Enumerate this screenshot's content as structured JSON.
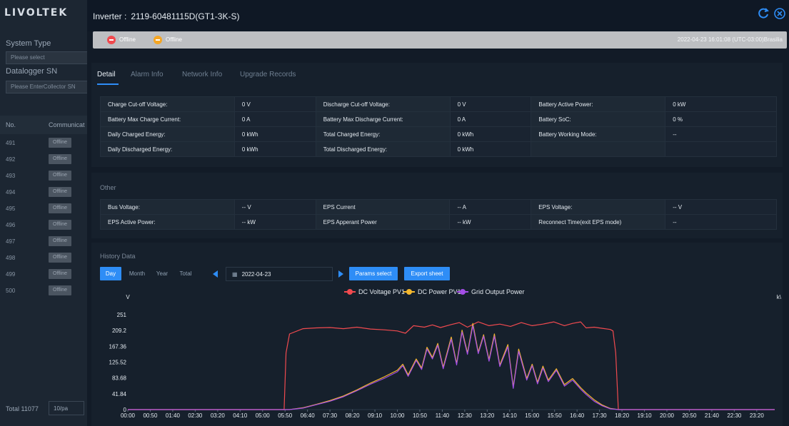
{
  "sidebar": {
    "logo": "LIVOLTEK",
    "system_type_label": "System Type",
    "system_type_placeholder": "Please select",
    "datalogger_label": "Datalogger SN",
    "datalogger_placeholder": "Please EnterCollector SN",
    "col_no": "No.",
    "col_comm": "Communicat",
    "rows": [
      {
        "no": "491",
        "status": "Offline"
      },
      {
        "no": "492",
        "status": "Offline"
      },
      {
        "no": "493",
        "status": "Offline"
      },
      {
        "no": "494",
        "status": "Offline"
      },
      {
        "no": "495",
        "status": "Offline"
      },
      {
        "no": "496",
        "status": "Offline"
      },
      {
        "no": "497",
        "status": "Offline"
      },
      {
        "no": "498",
        "status": "Offline"
      },
      {
        "no": "499",
        "status": "Offline"
      },
      {
        "no": "500",
        "status": "Offline"
      }
    ],
    "total": "Total 11077",
    "page_size": "10/pa"
  },
  "modal": {
    "title_label": "Inverter :",
    "title_value": "2119-60481115D(GT1-3K-S)",
    "status1": "Offline",
    "status2": "Offline",
    "timestamp": "2022-04-23 16:01:08 (UTC-03:00)Brasilia",
    "icons": {
      "refresh": "refresh-icon",
      "close": "close-icon"
    },
    "tabs": [
      "Detail",
      "Alarm Info",
      "Network Info",
      "Upgrade Records"
    ]
  },
  "battery": [
    [
      "Charge Cut-off Voltage:",
      "0 V",
      "Discharge Cut-off Voltage:",
      "0 V",
      "Battery Active Power:",
      "0 kW"
    ],
    [
      "Battery Max Charge Current:",
      "0 A",
      "Battery Max Discharge Current:",
      "0 A",
      "Battery SoC:",
      "0 %"
    ],
    [
      "Daily Charged Energy:",
      "0 kWh",
      "Total Charged Energy:",
      "0 kWh",
      "Battery Working Mode:",
      "--"
    ],
    [
      "Daily Discharged Energy:",
      "0 kWh",
      "Total Discharged Energy:",
      "0 kWh",
      "",
      ""
    ]
  ],
  "other": {
    "title": "Other",
    "rows": [
      [
        "Bus Voltage:",
        "-- V",
        "EPS Current",
        "-- A",
        "EPS Voltage:",
        "-- V"
      ],
      [
        "EPS Active Power:",
        "-- kW",
        "EPS Apperant Power",
        "-- kW",
        "Reconnect Time(exit EPS mode)",
        "--"
      ]
    ]
  },
  "history": {
    "title": "History Data",
    "ranges": [
      "Day",
      "Month",
      "Year",
      "Total"
    ],
    "active_range": "Day",
    "date": "2022-04-23",
    "params_btn": "Params select",
    "export_btn": "Export sheet"
  },
  "chart_data": {
    "type": "line",
    "ylabel_left": "V",
    "ylabel_right": "k\\",
    "yticks": [
      "0",
      "41.84",
      "83.68",
      "125.52",
      "167.36",
      "209.2",
      "251"
    ],
    "ylim": [
      0,
      251
    ],
    "xticks": [
      "00:00",
      "00:50",
      "01:40",
      "02:30",
      "03:20",
      "04:10",
      "05:00",
      "05:50",
      "06:40",
      "07:30",
      "08:20",
      "09:10",
      "10:00",
      "10:50",
      "11:40",
      "12:30",
      "13:20",
      "14:10",
      "15:00",
      "15:50",
      "16:40",
      "17:30",
      "18:20",
      "19:10",
      "20:00",
      "20:50",
      "21:40",
      "22:30",
      "23:20"
    ],
    "series": [
      {
        "name": "DC Voltage PV1",
        "color": "#f04a4f",
        "points": [
          [
            0,
            0
          ],
          [
            5.8,
            0
          ],
          [
            5.87,
            150
          ],
          [
            6.0,
            200
          ],
          [
            6.5,
            214
          ],
          [
            7.0,
            216
          ],
          [
            7.5,
            217
          ],
          [
            8.0,
            214
          ],
          [
            8.5,
            218
          ],
          [
            9.0,
            213
          ],
          [
            9.5,
            211
          ],
          [
            10.0,
            208
          ],
          [
            10.3,
            202
          ],
          [
            10.6,
            222
          ],
          [
            11.0,
            218
          ],
          [
            11.3,
            224
          ],
          [
            11.6,
            217
          ],
          [
            12.0,
            225
          ],
          [
            12.3,
            230
          ],
          [
            12.6,
            218
          ],
          [
            13.0,
            232
          ],
          [
            13.4,
            222
          ],
          [
            13.8,
            226
          ],
          [
            14.2,
            220
          ],
          [
            14.6,
            230
          ],
          [
            15.0,
            222
          ],
          [
            15.4,
            226
          ],
          [
            15.8,
            232
          ],
          [
            16.2,
            222
          ],
          [
            16.5,
            228
          ],
          [
            16.8,
            232
          ],
          [
            17.0,
            216
          ],
          [
            17.3,
            218
          ],
          [
            17.6,
            215
          ],
          [
            17.9,
            212
          ],
          [
            18.0,
            208
          ],
          [
            18.1,
            150
          ],
          [
            18.2,
            0
          ],
          [
            24,
            0
          ]
        ]
      },
      {
        "name": "DC Power PV1",
        "color": "#f5b82e",
        "points": [
          [
            0,
            0
          ],
          [
            6.0,
            0
          ],
          [
            6.5,
            5
          ],
          [
            7.0,
            14
          ],
          [
            7.5,
            24
          ],
          [
            8.0,
            36
          ],
          [
            8.5,
            52
          ],
          [
            9.0,
            70
          ],
          [
            9.5,
            86
          ],
          [
            10.0,
            104
          ],
          [
            10.2,
            120
          ],
          [
            10.4,
            92
          ],
          [
            10.7,
            134
          ],
          [
            10.9,
            110
          ],
          [
            11.1,
            165
          ],
          [
            11.3,
            138
          ],
          [
            11.5,
            175
          ],
          [
            11.7,
            112
          ],
          [
            12.0,
            192
          ],
          [
            12.2,
            122
          ],
          [
            12.4,
            210
          ],
          [
            12.6,
            150
          ],
          [
            12.8,
            228
          ],
          [
            13.0,
            152
          ],
          [
            13.2,
            198
          ],
          [
            13.4,
            132
          ],
          [
            13.6,
            200
          ],
          [
            13.8,
            118
          ],
          [
            14.1,
            172
          ],
          [
            14.3,
            60
          ],
          [
            14.5,
            160
          ],
          [
            14.8,
            82
          ],
          [
            15.0,
            120
          ],
          [
            15.2,
            72
          ],
          [
            15.4,
            115
          ],
          [
            15.6,
            78
          ],
          [
            15.9,
            108
          ],
          [
            16.2,
            66
          ],
          [
            16.5,
            82
          ],
          [
            16.8,
            58
          ],
          [
            17.0,
            44
          ],
          [
            17.3,
            26
          ],
          [
            17.6,
            12
          ],
          [
            17.9,
            3
          ],
          [
            18.2,
            0
          ],
          [
            24,
            0
          ]
        ]
      },
      {
        "name": "Grid Output Power",
        "color": "#a34ee6",
        "points": [
          [
            0,
            0
          ],
          [
            6.0,
            0
          ],
          [
            6.5,
            4
          ],
          [
            7.0,
            13
          ],
          [
            7.5,
            22
          ],
          [
            8.0,
            34
          ],
          [
            8.5,
            50
          ],
          [
            9.0,
            67
          ],
          [
            9.5,
            82
          ],
          [
            10.0,
            100
          ],
          [
            10.2,
            116
          ],
          [
            10.4,
            88
          ],
          [
            10.7,
            130
          ],
          [
            10.9,
            106
          ],
          [
            11.1,
            160
          ],
          [
            11.3,
            134
          ],
          [
            11.5,
            170
          ],
          [
            11.7,
            108
          ],
          [
            12.0,
            186
          ],
          [
            12.2,
            118
          ],
          [
            12.4,
            205
          ],
          [
            12.6,
            146
          ],
          [
            12.8,
            222
          ],
          [
            13.0,
            148
          ],
          [
            13.2,
            194
          ],
          [
            13.4,
            128
          ],
          [
            13.6,
            194
          ],
          [
            13.8,
            114
          ],
          [
            14.1,
            166
          ],
          [
            14.3,
            56
          ],
          [
            14.5,
            154
          ],
          [
            14.8,
            78
          ],
          [
            15.0,
            116
          ],
          [
            15.2,
            68
          ],
          [
            15.4,
            110
          ],
          [
            15.6,
            74
          ],
          [
            15.9,
            104
          ],
          [
            16.2,
            62
          ],
          [
            16.5,
            78
          ],
          [
            16.8,
            54
          ],
          [
            17.0,
            40
          ],
          [
            17.3,
            22
          ],
          [
            17.6,
            10
          ],
          [
            17.9,
            2
          ],
          [
            18.2,
            0
          ],
          [
            24,
            0
          ]
        ]
      }
    ]
  }
}
